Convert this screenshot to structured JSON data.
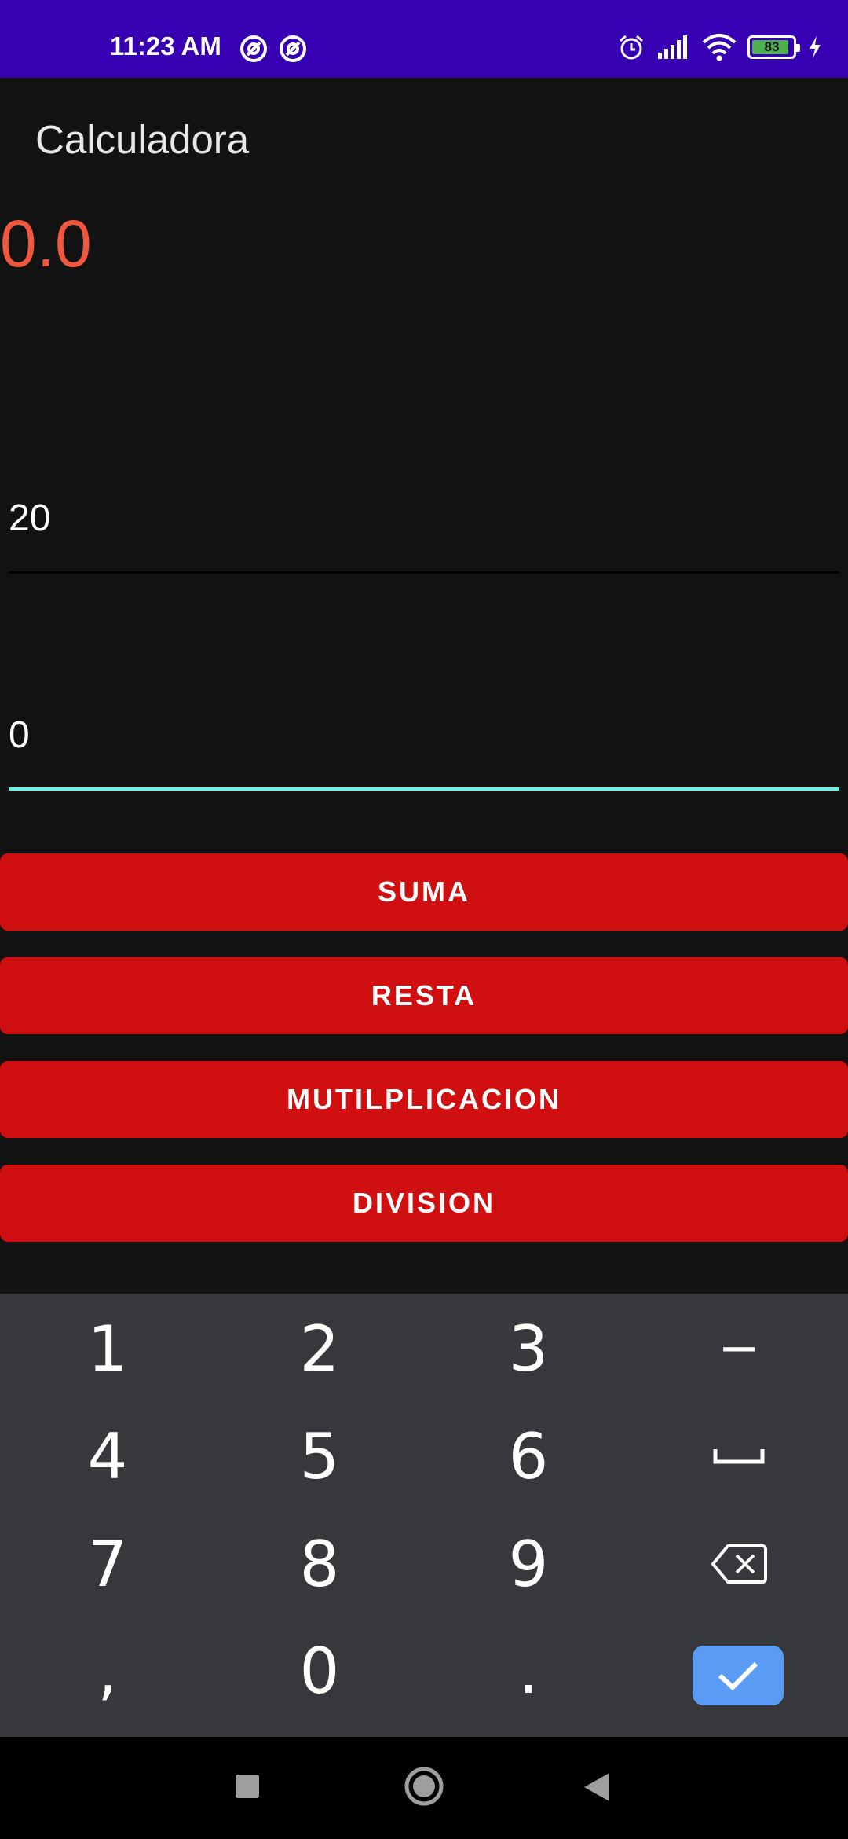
{
  "status_bar": {
    "time": "11:23 AM",
    "battery": "83"
  },
  "app": {
    "title": "Calculadora"
  },
  "result": "0.0",
  "inputs": {
    "first": "20",
    "second": "0"
  },
  "buttons": {
    "suma": "SUMA",
    "resta": "RESTA",
    "multiplicacion": "MUTILPLICACION",
    "division": "DIVISION"
  },
  "keyboard": {
    "keys": [
      "1",
      "2",
      "3",
      "−",
      "4",
      "5",
      "6",
      "7",
      "8",
      "9",
      ",",
      "0",
      "."
    ]
  },
  "colors": {
    "status_bar": "#3700b3",
    "result_text": "#f1573f",
    "button": "#cf0f10",
    "focused_underline": "#6ff0e0",
    "done_key": "#5a9bf5"
  }
}
